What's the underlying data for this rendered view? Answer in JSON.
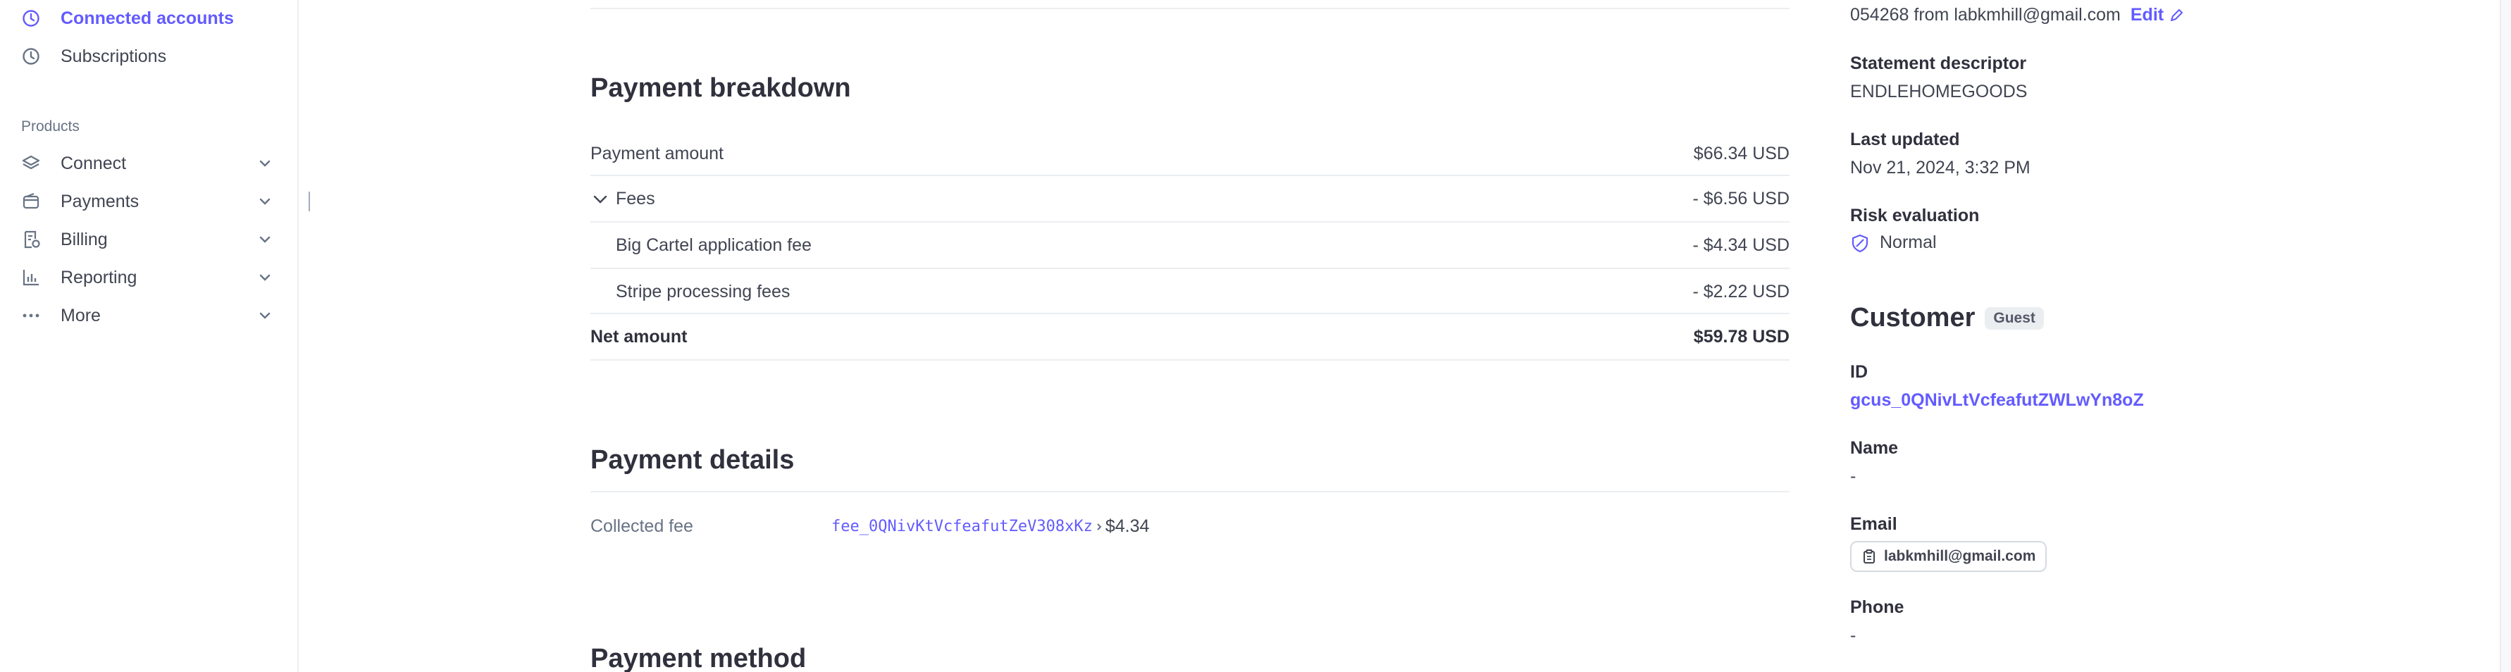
{
  "sidebar": {
    "top_items": [
      {
        "label": "Connected accounts",
        "icon": "clock-icon",
        "active": true
      },
      {
        "label": "Subscriptions",
        "icon": "clock-icon",
        "active": false
      }
    ],
    "section_label": "Products",
    "product_items": [
      {
        "label": "Connect",
        "icon": "connect-layers-icon"
      },
      {
        "label": "Payments",
        "icon": "wallet-icon"
      },
      {
        "label": "Billing",
        "icon": "invoice-icon"
      },
      {
        "label": "Reporting",
        "icon": "bar-chart-icon"
      },
      {
        "label": "More",
        "icon": "more-dots-icon"
      }
    ]
  },
  "breakdown": {
    "title": "Payment breakdown",
    "payment_amount_label": "Payment amount",
    "payment_amount_value": "$66.34 USD",
    "fees_label": "Fees",
    "fees_value": "- $6.56 USD",
    "app_fee_label": "Big Cartel application fee",
    "app_fee_value": "- $4.34 USD",
    "processing_label": "Stripe processing fees",
    "processing_value": "- $2.22 USD",
    "net_label": "Net amount",
    "net_value": "$59.78 USD"
  },
  "details": {
    "title": "Payment details",
    "collected_fee_label": "Collected fee",
    "collected_fee_id": "fee_0QNivKtVcfeafutZeV308xKz",
    "collected_fee_amount": "$4.34"
  },
  "method": {
    "title": "Payment method"
  },
  "panel": {
    "receipt_text": "054268 from labkmhill@gmail.com",
    "edit_label": "Edit",
    "descriptor_label": "Statement descriptor",
    "descriptor_value": "ENDLEHOMEGOODS",
    "updated_label": "Last updated",
    "updated_value": "Nov 21, 2024, 3:32 PM",
    "risk_label": "Risk evaluation",
    "risk_value": "Normal",
    "customer_title": "Customer",
    "customer_badge": "Guest",
    "id_label": "ID",
    "id_value": "gcus_0QNivLtVcfeafutZWLwYn8oZ",
    "name_label": "Name",
    "name_value": "-",
    "email_label": "Email",
    "email_value": "labkmhill@gmail.com",
    "phone_label": "Phone",
    "phone_value": "-"
  },
  "colors": {
    "accent": "#635bff",
    "text": "#30313d",
    "muted": "#687385",
    "divider": "#ebeef1"
  }
}
